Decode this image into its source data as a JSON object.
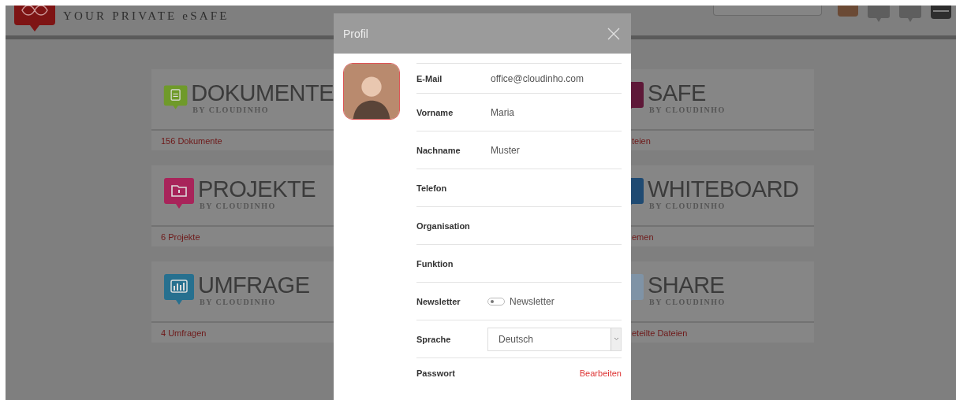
{
  "header": {
    "tagline": "YOUR PRIVATE eSAFE"
  },
  "left_column": [
    {
      "name": "DOKUMENTE",
      "byline": "BY CLOUDINHO",
      "count": "156 Dokumente",
      "color": "#6f9a2a"
    },
    {
      "name": "PROJEKTE",
      "byline": "BY CLOUDINHO",
      "count": "6 Projekte",
      "color": "#a8245a"
    },
    {
      "name": "UMFRAGE",
      "byline": "BY CLOUDINHO",
      "count": "4 Umfragen",
      "color": "#27708f"
    }
  ],
  "right_column": [
    {
      "name": "SAFE",
      "byline": "BY CLOUDINHO",
      "count": "teien",
      "color": "#5e1838"
    },
    {
      "name": "WHITEBOARD",
      "byline": "BY CLOUDINHO",
      "count": "emen",
      "color": "#1f4a72"
    },
    {
      "name": "SHARE",
      "byline": "BY CLOUDINHO",
      "count": "eteilte Dateien",
      "color": "#7f93a6"
    }
  ],
  "dialog": {
    "title": "Profil",
    "fields": [
      {
        "kind": "text",
        "label": "E-Mail",
        "value": "office@cloudinho.com"
      },
      {
        "kind": "text",
        "label": "Vorname",
        "value": "Maria"
      },
      {
        "kind": "text",
        "label": "Nachname",
        "value": "Muster"
      },
      {
        "kind": "text",
        "label": "Telefon"
      },
      {
        "kind": "text",
        "label": "Organisation"
      },
      {
        "kind": "text",
        "label": "Funktion"
      },
      {
        "kind": "toggle",
        "label": "Newsletter",
        "checked": false,
        "toggle_label": "Newsletter"
      },
      {
        "kind": "select",
        "label": "Sprache",
        "value": "Deutsch"
      },
      {
        "kind": "link",
        "label": "Passwort",
        "link": "Bearbeiten"
      }
    ]
  }
}
